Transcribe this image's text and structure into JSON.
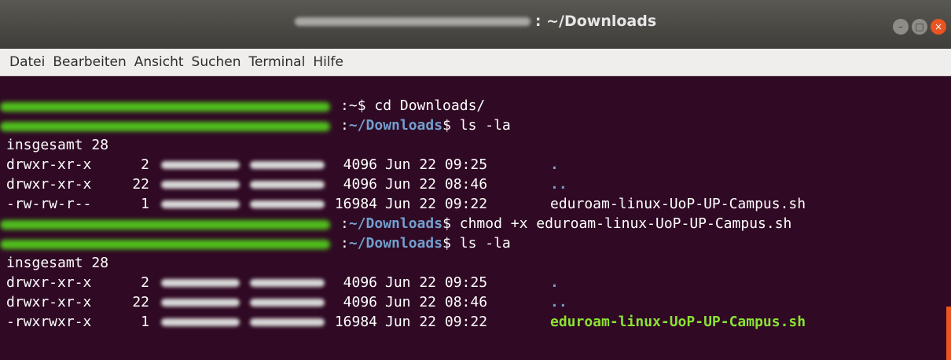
{
  "window": {
    "title": "~/Downloads",
    "buttons": {
      "minimize": "–",
      "maximize": "□",
      "close": "×"
    }
  },
  "menu": [
    "Datei",
    "Bearbeiten",
    "Ansicht",
    "Suchen",
    "Terminal",
    "Hilfe"
  ],
  "terminal": {
    "prompts": [
      {
        "cwd": "~",
        "cmd": "$ cd Downloads/"
      },
      {
        "cwd": "~/Downloads",
        "cmd": "$ ls -la"
      },
      {
        "cwd": "~/Downloads",
        "cmd": "$ chmod +x eduroam-linux-UoP-UP-Campus.sh"
      },
      {
        "cwd": "~/Downloads",
        "cmd": "$ ls -la"
      }
    ],
    "total1": "insgesamt 28",
    "listing1": [
      {
        "perms": "drwxr-xr-x",
        "links": "2",
        "size": "4096",
        "date": "Jun 22 09:25",
        "name": "."
      },
      {
        "perms": "drwxr-xr-x",
        "links": "22",
        "size": "4096",
        "date": "Jun 22 08:46",
        "name": ".."
      },
      {
        "perms": "-rw-rw-r--",
        "links": "1",
        "size": "16984",
        "date": "Jun 22 09:22",
        "name": "eduroam-linux-UoP-UP-Campus.sh"
      }
    ],
    "total2": "insgesamt 28",
    "listing2": [
      {
        "perms": "drwxr-xr-x",
        "links": "2",
        "size": "4096",
        "date": "Jun 22 09:25",
        "name": "."
      },
      {
        "perms": "drwxr-xr-x",
        "links": "22",
        "size": "4096",
        "date": "Jun 22 08:46",
        "name": ".."
      },
      {
        "perms": "-rwxrwxr-x",
        "links": "1",
        "size": "16984",
        "date": "Jun 22 09:22",
        "name": "eduroam-linux-UoP-UP-Campus.sh"
      }
    ]
  },
  "colors": {
    "background": "#300a24",
    "directory": "#729fcf",
    "executable": "#8ae234",
    "redaction": "#4fbe1d",
    "accent": "#e95420"
  }
}
